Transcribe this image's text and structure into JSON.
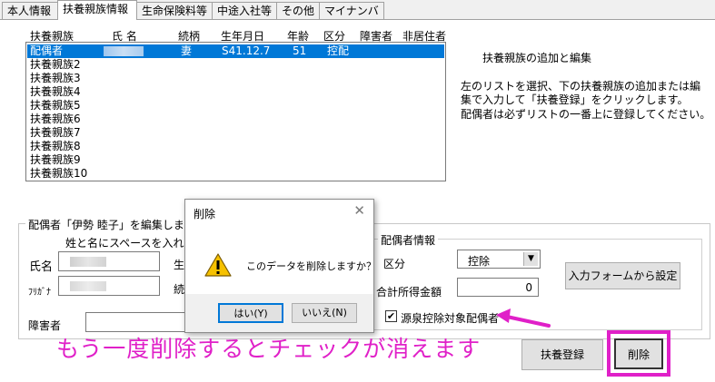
{
  "tabs": [
    "本人情報",
    "扶養親族情報",
    "生命保険料等",
    "中途入社等",
    "その他",
    "マイナンバー"
  ],
  "list": {
    "headers": [
      "扶養親族",
      "氏 名",
      "続柄",
      "生年月日",
      "年齢",
      "区分",
      "障害者",
      "非居住者"
    ],
    "selected": {
      "name": "配偶者",
      "relation": "妻",
      "birth": "S41.12.7",
      "age": "51",
      "category": "控配"
    },
    "others": [
      "扶養親族2",
      "扶養親族3",
      "扶養親族4",
      "扶養親族5",
      "扶養親族6",
      "扶養親族7",
      "扶養親族8",
      "扶養親族9",
      "扶養親族10"
    ]
  },
  "info": {
    "title": "扶養親族の追加と編集",
    "line1": "左のリストを選択、下の扶養親族の追加または編",
    "line2": "集で入力して「扶養登録」をクリックします。",
    "line3": "配偶者は必ずリストの一番上に登録してください。"
  },
  "edit": {
    "group_title": "配偶者「伊勢 睦子」を編集します。",
    "hint": "姓と名にスペースを入れてくださ",
    "name_label": "氏名",
    "kana_label": "ﾌﾘｶﾞﾅ",
    "birth_label_partial": "生",
    "relation_label_partial": "続",
    "disability_label": "障害者"
  },
  "spouse": {
    "group_title": "配偶者情報",
    "category_label": "区分",
    "category_value": "控除",
    "income_label": "合計所得金額",
    "income_value": "0",
    "withholding_label": "源泉控除対象配偶者",
    "withholding_checked": true
  },
  "buttons": {
    "input_form": "入力フォームから設定",
    "register": "扶養登録",
    "delete": "削除"
  },
  "dialog": {
    "title": "削除",
    "message": "このデータを削除しますか？",
    "yes": "はい(Y)",
    "no": "いいえ(N)"
  },
  "annotation": {
    "text": "もう一度削除するとチェックが消えます",
    "color": "#e020c8"
  }
}
